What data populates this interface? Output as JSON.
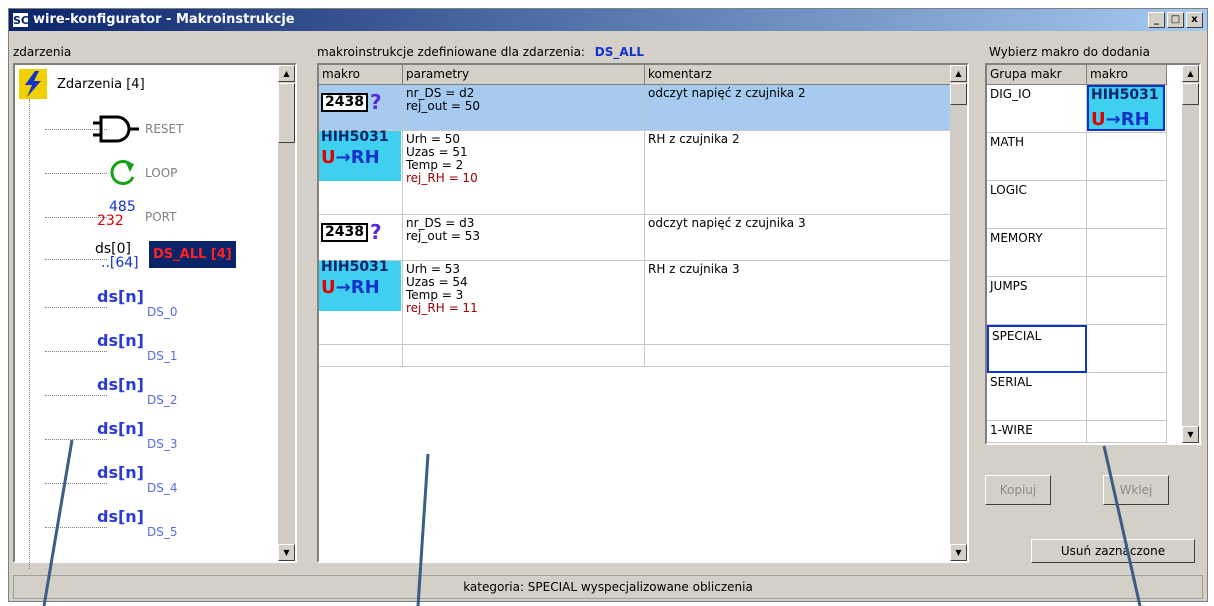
{
  "window": {
    "icon_text": "SC",
    "title": "wire-konfigurator - Makroinstrukcje",
    "min": "_",
    "max": "□",
    "close": "x"
  },
  "left": {
    "label": "zdarzenia",
    "root": "Zdarzenia [4]",
    "items": [
      {
        "label": "RESET",
        "icon": "and-gate-icon"
      },
      {
        "label": "LOOP",
        "icon": "loop-arrow-icon"
      },
      {
        "label": "PORT",
        "icon": "serial-port-icon",
        "icon_text_a": "485",
        "icon_text_b": "232"
      },
      {
        "label": "DS_ALL [4]",
        "icon": "ds-all-icon",
        "icon_text_a": "ds[0]",
        "icon_text_b": "..[64]",
        "selected": true
      },
      {
        "label": "DS_0",
        "icon_text": "ds[n]"
      },
      {
        "label": "DS_1",
        "icon_text": "ds[n]"
      },
      {
        "label": "DS_2",
        "icon_text": "ds[n]"
      },
      {
        "label": "DS_3",
        "icon_text": "ds[n]"
      },
      {
        "label": "DS_4",
        "icon_text": "ds[n]"
      },
      {
        "label": "DS_5",
        "icon_text": "ds[n]"
      }
    ]
  },
  "middle": {
    "label_prefix": "makroinstrukcje zdefiniowane  dla zdarzenia:",
    "label_event": "DS_ALL",
    "columns": [
      "makro",
      "parametry",
      "komentarz"
    ],
    "rows": [
      {
        "macro_text": "2438",
        "macro_q": "?",
        "params": [
          "nr_DS = d2",
          "rej_out = 50"
        ],
        "comment": "odczyt napięć z czujnika 2",
        "selected": true
      },
      {
        "macro_text": "HIH5031",
        "macro_u": "U",
        "macro_rh": "→RH",
        "params": [
          "Urh = 50",
          "Uzas = 51",
          "Temp = 2",
          "rej_RH = 10"
        ],
        "comment": "RH z czujnika 2"
      },
      {
        "macro_text": "2438",
        "macro_q": "?",
        "params": [
          "nr_DS = d3",
          "rej_out = 53"
        ],
        "comment": "odczyt napięć z czujnika 3"
      },
      {
        "macro_text": "HIH5031",
        "macro_u": "U",
        "macro_rh": "→RH",
        "params": [
          "Urh = 53",
          "Uzas = 54",
          "Temp = 3",
          "rej_RH = 11"
        ],
        "comment": "RH z czujnika 3"
      }
    ]
  },
  "right": {
    "label": "Wybierz makro do dodania",
    "columns": [
      "Grupa makr",
      "makro"
    ],
    "groups": [
      "DIG_IO",
      "MATH",
      "LOGIC",
      "MEMORY",
      "JUMPS",
      "SPECIAL",
      "SERIAL",
      "1-WIRE"
    ],
    "first_macro": {
      "text": "HIH5031",
      "u": "U",
      "rh": "→RH"
    },
    "copy": "Kopiuj",
    "paste": "Wklej",
    "delete": "Usuń zaznaczone"
  },
  "status": "kategoria: SPECIAL wyspecjalizowane obliczenia",
  "colors": {
    "titlebar": "#0a246a",
    "selection": "#a6caf0",
    "event": "#1133cc",
    "dsall_bg": "#0a246a",
    "dsall_fg": "#ff2020"
  }
}
